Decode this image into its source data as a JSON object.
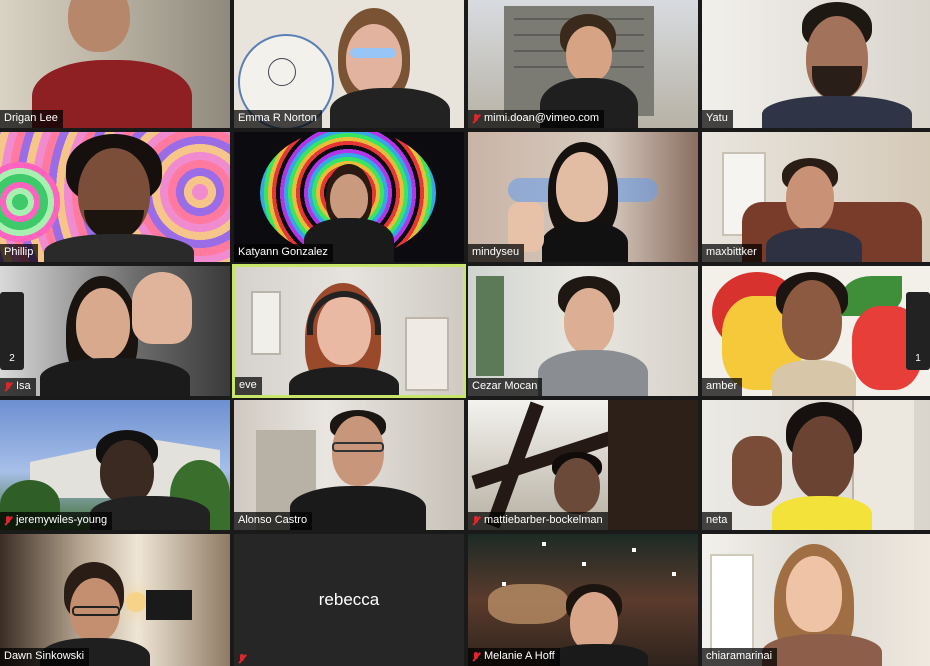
{
  "participants": [
    {
      "name": "Drigan Lee",
      "muted": false
    },
    {
      "name": "Emma R Norton",
      "muted": false
    },
    {
      "name": "mimi.doan@vimeo.com",
      "muted": true
    },
    {
      "name": "Yatu",
      "muted": false
    },
    {
      "name": "Phillip",
      "muted": false
    },
    {
      "name": "Katyann Gonzalez",
      "muted": false
    },
    {
      "name": "mindyseu",
      "muted": false
    },
    {
      "name": "maxbittker",
      "muted": false
    },
    {
      "name": "Isa",
      "muted": true
    },
    {
      "name": "eve",
      "muted": false
    },
    {
      "name": "Cezar Mocan",
      "muted": false
    },
    {
      "name": "amber",
      "muted": false
    },
    {
      "name": "jeremywiles-young",
      "muted": true
    },
    {
      "name": "Alonso Castro",
      "muted": false
    },
    {
      "name": "mattiebarber-bockelman",
      "muted": true
    },
    {
      "name": "neta",
      "muted": false
    },
    {
      "name": "Dawn Sinkowski",
      "muted": false
    },
    {
      "name": "rebecca",
      "muted": true
    },
    {
      "name": "Melanie A Hoff",
      "muted": true
    },
    {
      "name": "chiaramarinai",
      "muted": false
    }
  ],
  "pagination": {
    "prev_page": "2",
    "next_page": "1"
  },
  "colors": {
    "active_speaker_border": "#c8e66a",
    "muted_icon": "#e0262a"
  }
}
